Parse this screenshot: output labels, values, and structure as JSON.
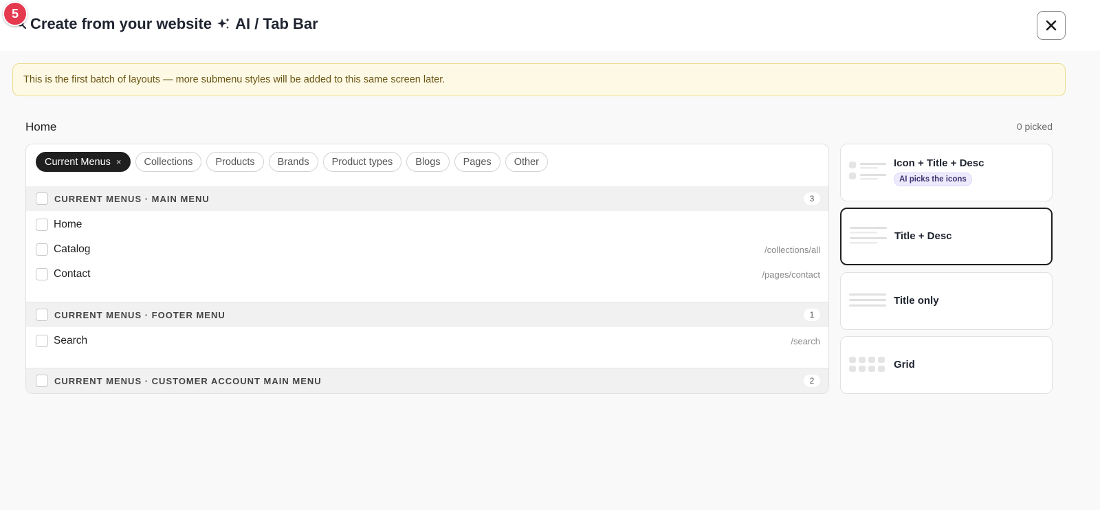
{
  "step": {
    "number": "5"
  },
  "header": {
    "title": "Create from your website",
    "ai_suffix": "AI / Tab Bar",
    "close_label": "✕"
  },
  "notice": {
    "text": "This is the first batch of layouts — more submenu styles will be added to this same screen later."
  },
  "breadcrumb": {
    "label": "Home"
  },
  "picked": {
    "text": "0 picked"
  },
  "filters": {
    "chips": [
      {
        "label": "Current Menus",
        "active": true,
        "remove": "×"
      },
      {
        "label": "Collections"
      },
      {
        "label": "Products"
      },
      {
        "label": "Brands"
      },
      {
        "label": "Product types"
      },
      {
        "label": "Blogs"
      },
      {
        "label": "Pages"
      },
      {
        "label": "Other"
      }
    ]
  },
  "groups": [
    {
      "title": "CURRENT MENUS · MAIN MENU",
      "count": "3",
      "items": [
        {
          "label": "Home",
          "path": ""
        },
        {
          "label": "Catalog",
          "path": "/collections/all"
        },
        {
          "label": "Contact",
          "path": "/pages/contact"
        }
      ]
    },
    {
      "title": "CURRENT MENUS · FOOTER MENU",
      "count": "1",
      "items": [
        {
          "label": "Search",
          "path": "/search"
        }
      ]
    },
    {
      "title": "CURRENT MENUS · CUSTOMER ACCOUNT MAIN MENU",
      "count": "2",
      "items": []
    }
  ],
  "layouts": [
    {
      "title": "Icon + Title + Desc",
      "badge": "AI picks the icons",
      "icon": "icon-title-desc-thumb-icon",
      "selected": false
    },
    {
      "title": "Title + Desc",
      "icon": "title-desc-thumb-icon",
      "selected": true
    },
    {
      "title": "Title only",
      "icon": "title-only-thumb-icon",
      "selected": false
    },
    {
      "title": "Grid",
      "icon": "grid-thumb-icon",
      "selected": false
    }
  ],
  "colors": {
    "step_badge": "#e53950",
    "active_chip": "#1f1f1f",
    "notice_bg": "#fdf9e4",
    "notice_text": "#6a5413",
    "ai_badge_bg": "#eeeafd"
  }
}
